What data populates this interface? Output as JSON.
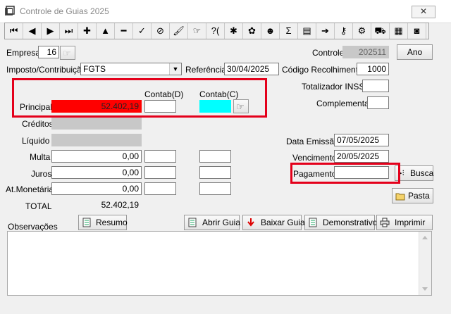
{
  "window": {
    "title": "Controle de Guias 2025",
    "close_glyph": "✕"
  },
  "toolbar": {
    "buttons": [
      {
        "name": "first-record-icon",
        "glyph": "⏮"
      },
      {
        "name": "prior-record-icon",
        "glyph": "◀"
      },
      {
        "name": "next-record-icon",
        "glyph": "▶"
      },
      {
        "name": "last-record-icon",
        "glyph": "⏭"
      },
      {
        "name": "insert-record-icon",
        "glyph": "✚"
      },
      {
        "name": "edit-record-icon",
        "glyph": "▲"
      },
      {
        "name": "delete-record-icon",
        "glyph": "━"
      },
      {
        "name": "post-record-icon",
        "glyph": "✓"
      },
      {
        "name": "cancel-record-icon",
        "glyph": "⊘"
      },
      {
        "name": "clean-icon",
        "glyph": "🖌"
      },
      {
        "name": "search-form-icon",
        "glyph": "☞"
      },
      {
        "name": "query-icon",
        "glyph": "?("
      },
      {
        "name": "tools-icon",
        "glyph": "✱"
      },
      {
        "name": "wizard-icon",
        "glyph": "✿"
      },
      {
        "name": "user-icon",
        "glyph": "☻"
      },
      {
        "name": "sum-icon",
        "glyph": "Σ"
      },
      {
        "name": "report-icon",
        "glyph": "▤"
      },
      {
        "name": "export-icon",
        "glyph": "➔"
      },
      {
        "name": "key-icon",
        "glyph": "⚷"
      },
      {
        "name": "settings-icon",
        "glyph": "⚙"
      },
      {
        "name": "vehicle-icon",
        "glyph": "⛟"
      },
      {
        "name": "calendar-icon",
        "glyph": "▦"
      },
      {
        "name": "stop-icon",
        "glyph": "◙"
      }
    ]
  },
  "form": {
    "empresa_label": "Empresa",
    "empresa_value": "16",
    "controle_label": "Controle",
    "controle_value": "202511",
    "ano_button": "Ano",
    "imposto_label": "Imposto/Contribuição",
    "imposto_value": "FGTS",
    "referencia_label": "Referência",
    "referencia_value": "30/04/2025",
    "codigo_label": "Código Recolhimento",
    "codigo_value": "1000",
    "totalizador_label": "Totalizador INSS",
    "totalizador_value": "",
    "complementar_label": "Complementar",
    "complementar_value": "",
    "contab_d_label": "Contab(D)",
    "contab_c_label": "Contab(C)",
    "principal_label": "Principal",
    "principal_value": "52.402,19",
    "creditos_label": "Créditos",
    "liquido_label": "Líquido",
    "multa_label": "Multa",
    "multa_value": "0,00",
    "juros_label": "Juros",
    "juros_value": "0,00",
    "atmonetaria_label": "At.Monetária",
    "atmonetaria_value": "0,00",
    "total_label": "TOTAL",
    "total_value": "52.402,19",
    "data_emissao_label": "Data Emissão",
    "data_emissao_value": "07/05/2025",
    "vencimento_label": "Vencimento",
    "vencimento_value": "20/05/2025",
    "pagamento_label": "Pagamento",
    "pagamento_value": "",
    "busca_button": "Busca",
    "pasta_button": "Pasta",
    "observacoes_label": "Observações",
    "resumo_button": "Resumo",
    "abrir_guia_button": "Abrir Guia",
    "baixar_guia_button": "Baixar Guia",
    "demonstrativo_button": "Demonstrativo",
    "imprimir_button": "Imprimir",
    "observacoes_value": ""
  },
  "colors": {
    "highlight_red": "#e4001b",
    "principal_bg": "#ff0000",
    "contab_c_bg": "#00ffff",
    "disabled_gray": "#c8c8c8"
  }
}
